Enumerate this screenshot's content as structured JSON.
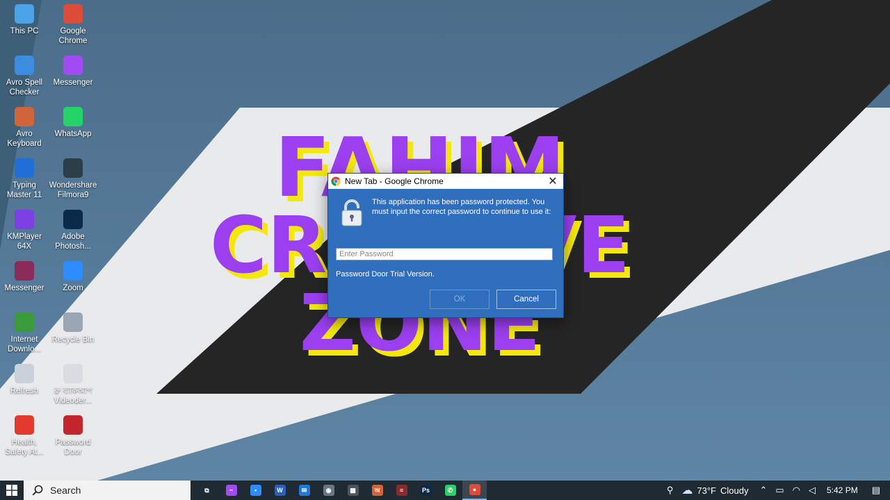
{
  "desktop": {
    "icons": [
      {
        "label": "This PC",
        "icon": "this-pc-icon",
        "color": "#4aa3e6"
      },
      {
        "label": "Google Chrome",
        "icon": "chrome-icon",
        "color": "#dd4b39"
      },
      {
        "label": "Avro Spell Checker",
        "icon": "check-icon",
        "color": "#3c8ce0"
      },
      {
        "label": "Messenger",
        "icon": "messenger-icon",
        "color": "#a04cf2"
      },
      {
        "label": "Avro Keyboard",
        "icon": "keyboard-icon",
        "color": "#d0643b"
      },
      {
        "label": "WhatsApp",
        "icon": "whatsapp-icon",
        "color": "#25d366"
      },
      {
        "label": "Typing Master 11",
        "icon": "typing-master-icon",
        "color": "#1f6fd6"
      },
      {
        "label": "Wondershare Filmora9",
        "icon": "filmora-icon",
        "color": "#2c3e48"
      },
      {
        "label": "KMPlayer 64X",
        "icon": "kmplayer-icon",
        "color": "#7b3fe4"
      },
      {
        "label": "Adobe Photosh...",
        "icon": "photoshop-icon",
        "color": "#0b2a4a"
      },
      {
        "label": "Messenger",
        "icon": "winrar-icon",
        "color": "#8a2b5a"
      },
      {
        "label": "Zoom",
        "icon": "zoom-icon",
        "color": "#2d8cff"
      },
      {
        "label": "Internet Downlo...",
        "icon": "idm-icon",
        "color": "#3a9b3a"
      },
      {
        "label": "Recycle Bin",
        "icon": "recycle-bin-icon",
        "color": "#9aa7b3"
      },
      {
        "label": "Refresh",
        "icon": "refresh-icon",
        "color": "#c9d2da"
      },
      {
        "label": "ব্রু ব্যাকআপ Videoder...",
        "icon": "videoder-icon",
        "color": "#d9dde1"
      },
      {
        "label": "Health, Safety At...",
        "icon": "pdf-icon",
        "color": "#e23b2e"
      },
      {
        "label": "Password Door",
        "icon": "password-door-icon",
        "color": "#c4262e"
      }
    ],
    "wallpaper": {
      "text_line1": "FAHIM",
      "text_line2": "CREATIVE",
      "text_line3": "ZONE",
      "text_color": "#9b3ff0",
      "shadow_color": "#f3e80a"
    }
  },
  "dialog": {
    "title": "New Tab - Google Chrome",
    "message": "This application has been password protected. You must input the correct password to continue to use it:",
    "password_placeholder": "Enter Password",
    "password_value": "",
    "trial_text": "Password Door Trial Version.",
    "ok_label": "OK",
    "cancel_label": "Cancel",
    "background": "#2f6dbd"
  },
  "taskbar": {
    "search_placeholder": "Search",
    "apps": [
      {
        "name": "task-view-icon",
        "glyph": "⧉",
        "color": "#1f2a33"
      },
      {
        "name": "messenger-icon",
        "glyph": "~",
        "color": "#a04cf2"
      },
      {
        "name": "zoom-icon",
        "glyph": "•",
        "color": "#2d8cff"
      },
      {
        "name": "word-icon",
        "glyph": "W",
        "color": "#2b5fb8"
      },
      {
        "name": "mail-icon",
        "glyph": "✉",
        "color": "#1f7ad6"
      },
      {
        "name": "camera-icon",
        "glyph": "◉",
        "color": "#6b7680"
      },
      {
        "name": "calculator-icon",
        "glyph": "▦",
        "color": "#4a5560"
      },
      {
        "name": "avro-icon",
        "glyph": "অ",
        "color": "#d0643b"
      },
      {
        "name": "winrar-taskbar-icon",
        "glyph": "≡",
        "color": "#8a2b2b"
      },
      {
        "name": "photoshop-taskbar-icon",
        "glyph": "Ps",
        "color": "#0b2a4a"
      },
      {
        "name": "whatsapp-taskbar-icon",
        "glyph": "✆",
        "color": "#25d366"
      },
      {
        "name": "chrome-taskbar-icon",
        "glyph": "●",
        "color": "#dd4b39"
      }
    ],
    "tray": {
      "weather_temp": "73°F",
      "weather_desc": "Cloudy",
      "time": "5:42 PM"
    }
  }
}
